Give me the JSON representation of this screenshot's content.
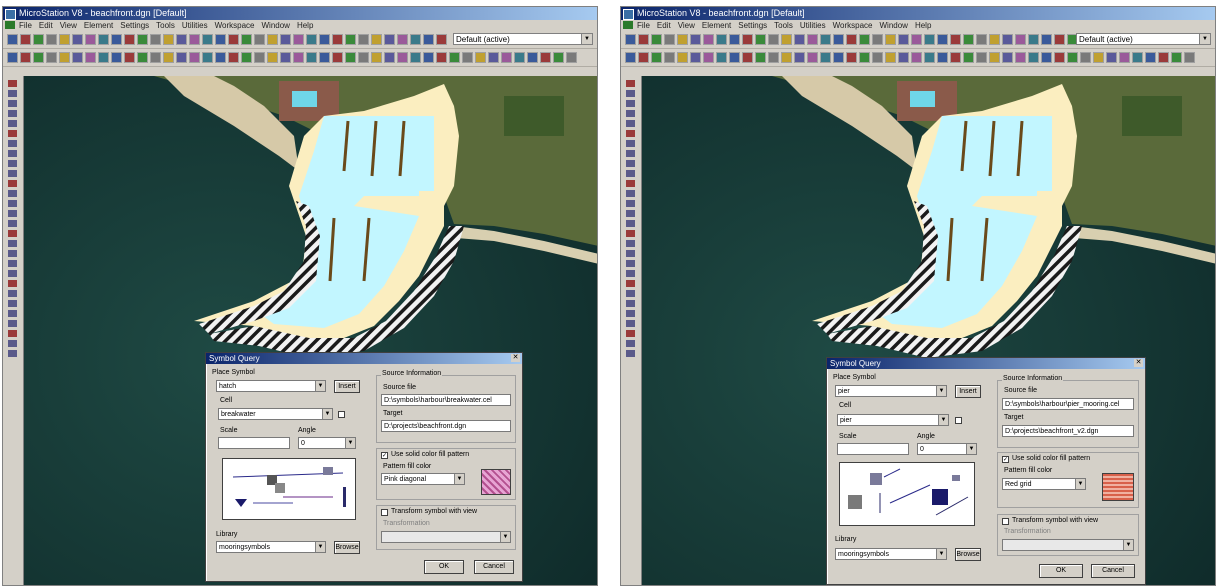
{
  "left": {
    "window_title": "MicroStation V8 - beachfront.dgn [Default]",
    "menu": [
      "File",
      "Edit",
      "View",
      "Element",
      "Settings",
      "Tools",
      "Utilities",
      "Workspace",
      "Window",
      "Help"
    ],
    "level_combo": "Default  (active)",
    "dialog": {
      "title": "Symbol Query",
      "tabs_label": "Place Symbol",
      "name_value": "hatch",
      "insert_btn": "Insert",
      "cell_label": "Cell",
      "cell_value": "breakwater",
      "scale_label": "Scale",
      "angle_label": "Angle",
      "angle_value": "0",
      "library_label": "Library",
      "library_value": "mooringsymbols",
      "browse_btn": "Browse",
      "source_group": "Source Information",
      "source_label": "Source file",
      "source_value": "D:\\symbols\\harbour\\breakwater.cel",
      "target_label": "Target",
      "target_value": "D:\\projects\\beachfront.dgn",
      "fill_check": "Use solid color fill pattern",
      "fill_label": "Pattern fill color",
      "fill_value": "Pink diagonal",
      "transform_check": "Transform symbol with view",
      "transform_label": "Transformation",
      "ok_btn": "OK",
      "cancel_btn": "Cancel"
    }
  },
  "right": {
    "window_title": "MicroStation V8 - beachfront.dgn [Default]",
    "menu": [
      "File",
      "Edit",
      "View",
      "Element",
      "Settings",
      "Tools",
      "Utilities",
      "Workspace",
      "Window",
      "Help"
    ],
    "level_combo": "Default  (active)",
    "dialog": {
      "title": "Symbol Query",
      "tabs_label": "Place Symbol",
      "name_value": "pier",
      "insert_btn": "Insert",
      "cell_label": "Cell",
      "cell_value": "pier",
      "scale_label": "Scale",
      "angle_label": "Angle",
      "angle_value": "0",
      "library_label": "Library",
      "library_value": "mooringsymbols",
      "browse_btn": "Browse",
      "source_group": "Source Information",
      "source_label": "Source file",
      "source_value": "D:\\symbols\\harbour\\pier_mooring.cel",
      "target_label": "Target",
      "target_value": "D:\\projects\\beachfront_v2.dgn",
      "fill_check": "Use solid color fill pattern",
      "fill_label": "Pattern fill color",
      "fill_value": "Red grid",
      "transform_check": "Transform symbol with view",
      "transform_label": "Transformation",
      "ok_btn": "OK",
      "cancel_btn": "Cancel"
    }
  },
  "colors": {
    "water": "#c2f6ff",
    "sand": "#fbeec0",
    "sea": "#173a36",
    "titlebar": "#0a246a",
    "pink_fill": "#e7a4d3",
    "red_fill": "#d8604a"
  }
}
